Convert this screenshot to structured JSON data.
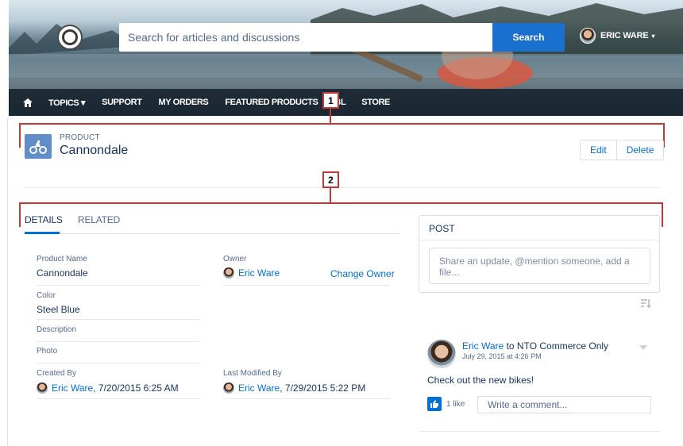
{
  "header": {
    "search_placeholder": "Search for articles and discussions",
    "search_button": "Search",
    "user_name": "ERIC WARE",
    "user_caret": "▾"
  },
  "nav": {
    "items": [
      "TOPICS ▾",
      "SUPPORT",
      "MY ORDERS",
      "FEATURED PRODUCTS",
      "BL",
      "STORE"
    ]
  },
  "callouts": {
    "one": "1",
    "two": "2"
  },
  "record": {
    "type": "PRODUCT",
    "name": "Cannondale",
    "actions": {
      "edit": "Edit",
      "delete": "Delete"
    }
  },
  "tabs": {
    "details": "DETAILS",
    "related": "RELATED"
  },
  "fields": {
    "product_name": {
      "label": "Product Name",
      "value": "Cannondale"
    },
    "owner": {
      "label": "Owner",
      "value": "Eric Ware",
      "action": "Change Owner"
    },
    "color": {
      "label": "Color",
      "value": "Steel Blue"
    },
    "description": {
      "label": "Description"
    },
    "photo": {
      "label": "Photo"
    },
    "created_by": {
      "label": "Created By",
      "name": "Eric Ware",
      "date": ", 7/20/2015 6:25 AM"
    },
    "last_modified_by": {
      "label": "Last Modified By",
      "name": "Eric Ware",
      "date": ", 7/29/2015 5:22 PM"
    }
  },
  "post": {
    "title": "POST",
    "placeholder": "Share an update, @mention someone, add a file..."
  },
  "feed": {
    "author": "Eric Ware",
    "to_text": " to NTO Commerce Only",
    "date": "July 29, 2015 at 4:26 PM",
    "body": "Check out the new bikes!",
    "likes": "1 like",
    "comment_placeholder": "Write a comment..."
  },
  "colors": {
    "brand_blue": "#0070d2",
    "callout_red": "#c23934",
    "product_icon": "#5f8ec8"
  }
}
